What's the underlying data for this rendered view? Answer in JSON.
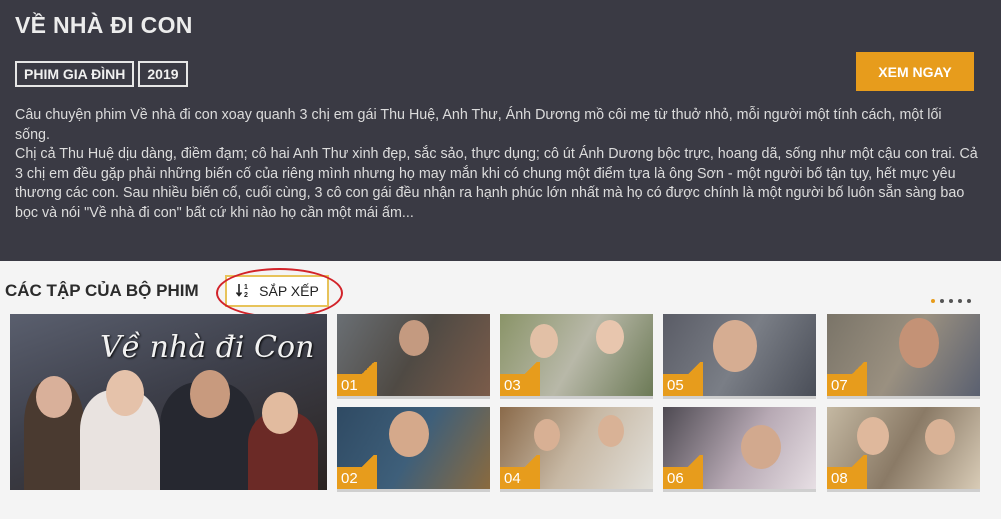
{
  "movie": {
    "title": "VỀ NHÀ ĐI CON",
    "tags": [
      "PHIM GIA ĐÌNH",
      "2019"
    ],
    "watch_label": "XEM NGAY",
    "description": [
      "Câu chuyện phim Về nhà đi con xoay quanh 3 chị em gái Thu Huệ, Anh Thư, Ánh Dương mồ côi mẹ từ thuở nhỏ, mỗi người một tính cách, một lối sống.",
      "Chị cả Thu Huệ dịu dàng, điềm đạm; cô hai Anh Thư xinh đẹp, sắc sảo, thực dụng; cô út Ánh Dương bộc trực, hoang dã, sống như một cậu con trai. Cả 3 chị em đều gặp phải những biến cố của riêng mình nhưng họ may mắn khi có chung một điểm tựa là ông Sơn - một người bố tận tụy, hết mực yêu thương các con. Sau nhiều biến cố, cuối cùng, 3 cô con gái đều nhận ra hạnh phúc lớn nhất mà họ có được chính là một người bố luôn sẵn sàng bao bọc và nói \"Về nhà đi con\" bất cứ khi nào họ cần một mái ấm..."
    ]
  },
  "episodes_section": {
    "heading": "CÁC TẬP CỦA BỘ PHIM",
    "sort_label": "SẮP XẾP",
    "sort_icon": "sort-az-icon",
    "poster_title": "Về nhà đi Con",
    "pagination_dots": 5,
    "active_dot": 0,
    "episodes": [
      {
        "num": "01"
      },
      {
        "num": "02"
      },
      {
        "num": "03"
      },
      {
        "num": "04"
      },
      {
        "num": "05"
      },
      {
        "num": "06"
      },
      {
        "num": "07"
      },
      {
        "num": "08"
      }
    ]
  },
  "colors": {
    "hero_bg": "#3a3a44",
    "accent": "#e79c1c",
    "highlight_circle": "#d2232a"
  }
}
